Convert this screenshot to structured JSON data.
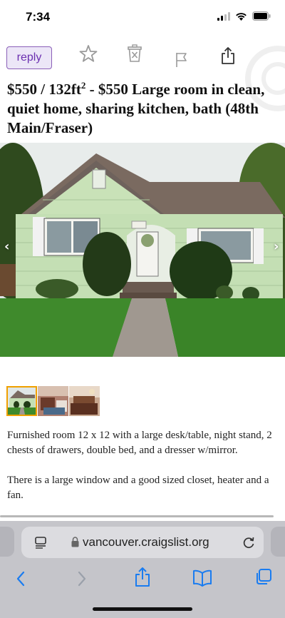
{
  "status_bar": {
    "time": "7:34"
  },
  "toolbar": {
    "reply_label": "reply"
  },
  "posting": {
    "title_main": "$550 / 132ft",
    "title_sup": "2",
    "title_rest": " - $550 Large room in clean, quiet home, sharing kitchen, bath (48th Main/Fraser)",
    "body_paragraph_1": "Furnished room 12 x 12 with a large desk/table, night stand, 2 chests of drawers, double bed, and a dresser w/mirror.",
    "body_paragraph_2": "There is a large window and a good sized closet, heater and a fan."
  },
  "photo": {
    "prev_arrow": "‹",
    "next_arrow": "›",
    "thumbnail_count": 3,
    "active_thumbnail": 1
  },
  "browser": {
    "url": "vancouver.craigslist.org"
  },
  "colors": {
    "reply_bg": "#ece6f7",
    "reply_text": "#6b2fb0",
    "thumb_active": "#f0a000",
    "ios_blue": "#1a7cf0"
  }
}
